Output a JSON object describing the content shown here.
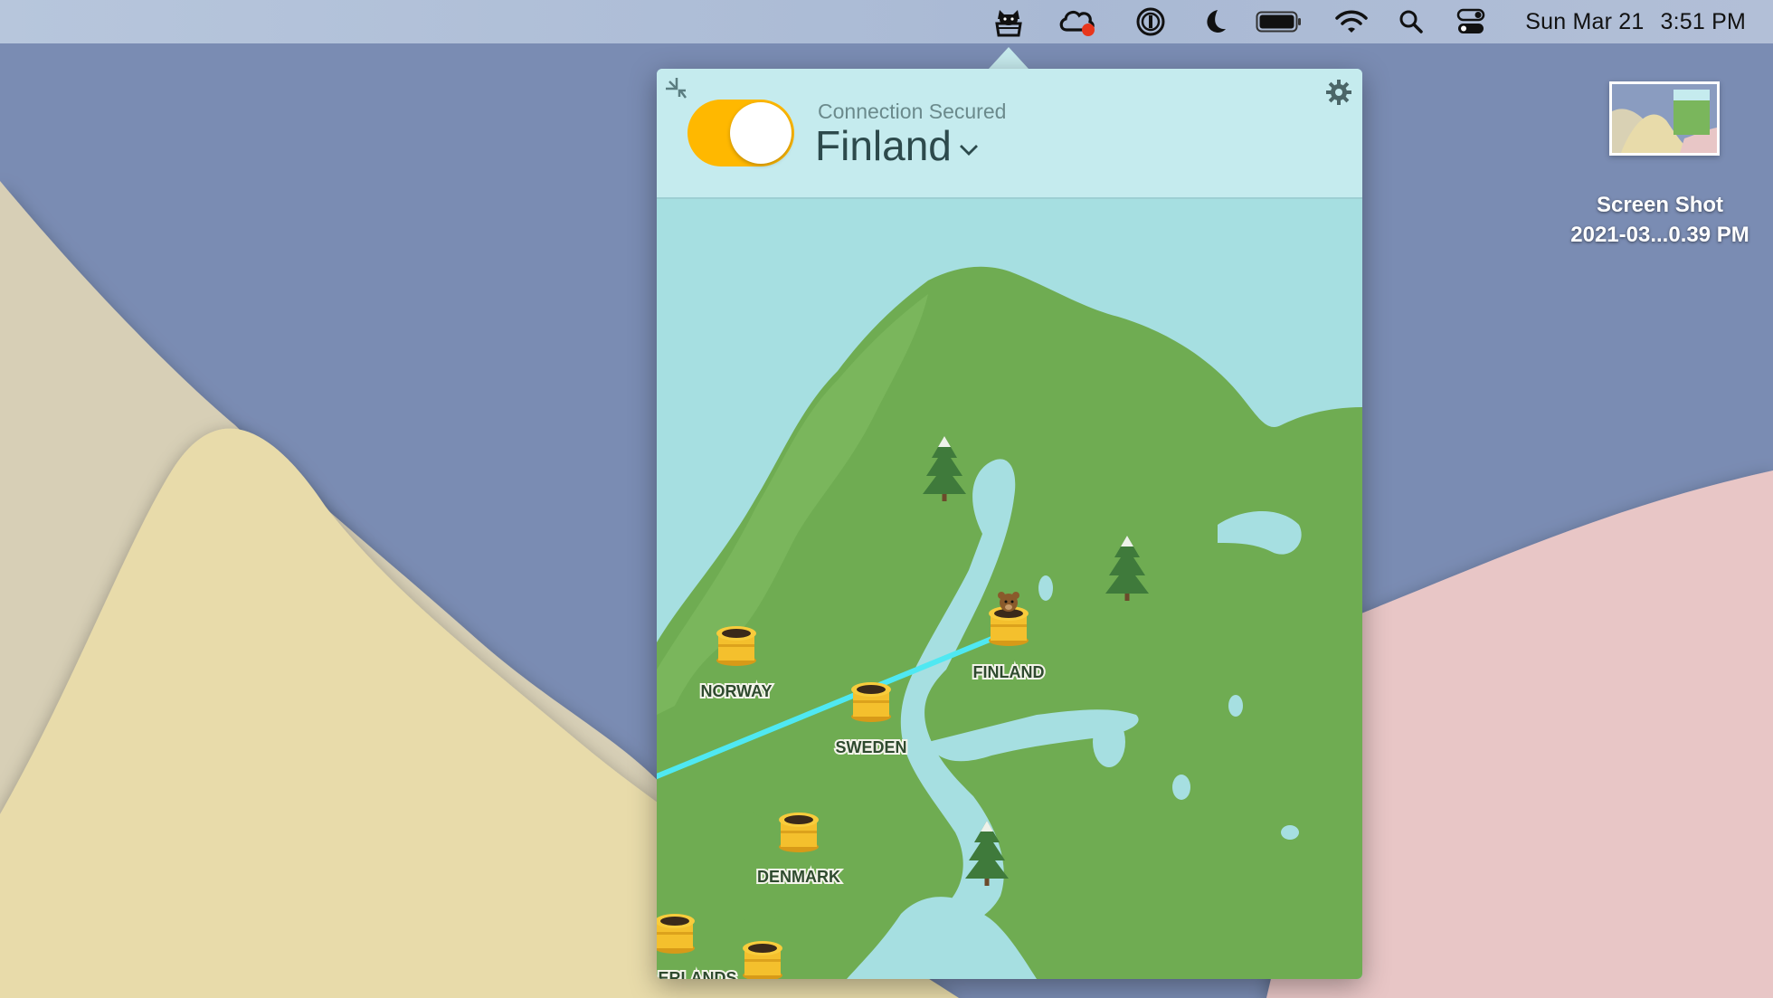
{
  "menubar": {
    "icons": [
      "tunnelbear-icon",
      "creative-cloud-icon",
      "onepassword-icon",
      "moon-icon",
      "battery-icon",
      "wifi-icon",
      "spotlight-search-icon",
      "control-center-icon"
    ],
    "date": "Sun Mar 21",
    "time": "3:51 PM"
  },
  "popover": {
    "status": "Connection Secured",
    "location": "Finland",
    "toggle_on": true,
    "accent_color": "#ffb800",
    "map": {
      "countries": [
        "NORWAY",
        "SWEDEN",
        "FINLAND",
        "DENMARK",
        "ERLANDS"
      ],
      "connected": "FINLAND",
      "tunnel_color": "#4fe8f2"
    }
  },
  "desktop": {
    "file_name_line1": "Screen Shot",
    "file_name_line2": "2021-03...0.39 PM"
  }
}
